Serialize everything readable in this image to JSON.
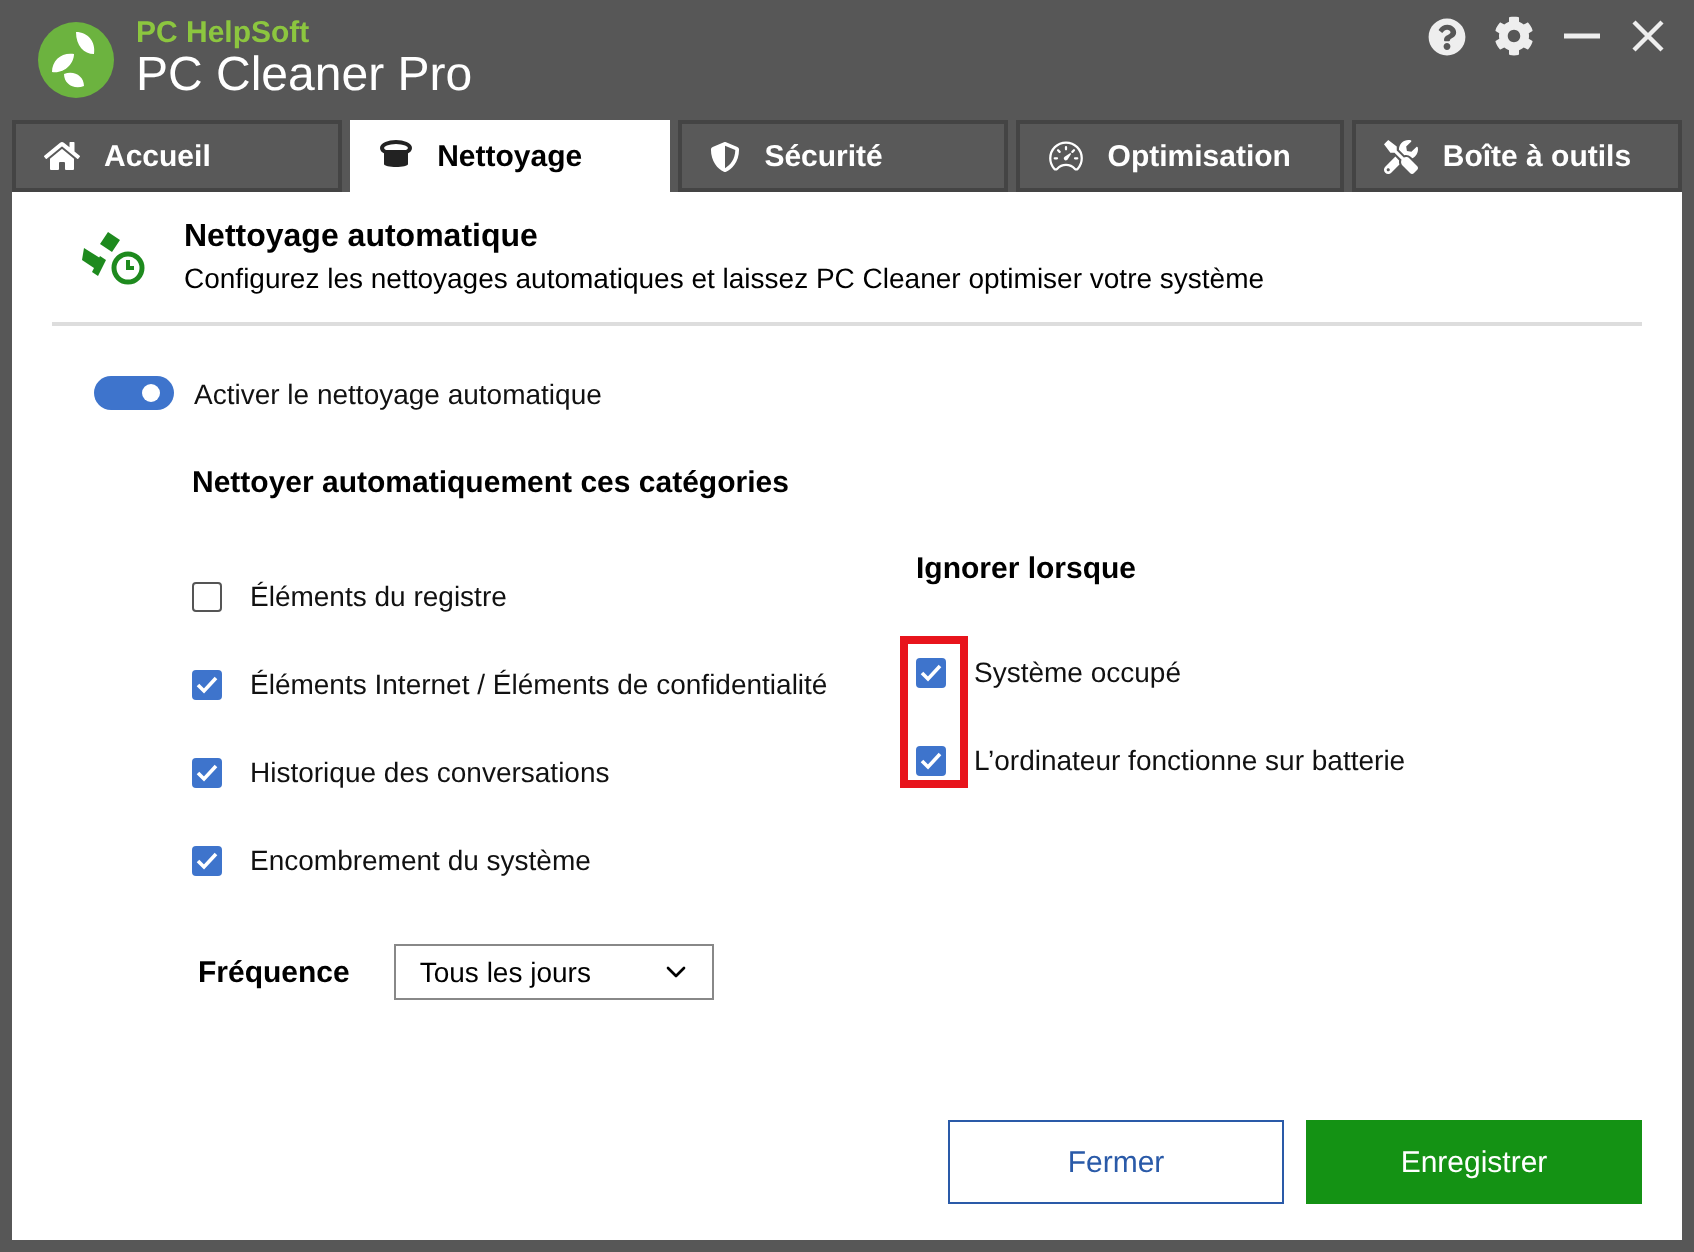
{
  "app": {
    "brand": "PC HelpSoft",
    "title": "PC Cleaner Pro"
  },
  "tabs": [
    {
      "label": "Accueil",
      "kind": "home",
      "selected": false
    },
    {
      "label": "Nettoyage",
      "kind": "clean",
      "selected": true
    },
    {
      "label": "Sécurité",
      "kind": "shield",
      "selected": false
    },
    {
      "label": "Optimisation",
      "kind": "gauge",
      "selected": false
    },
    {
      "label": "Boîte à outils",
      "kind": "tools",
      "selected": false
    }
  ],
  "header": {
    "title": "Nettoyage automatique",
    "subtitle": "Configurez les nettoyages automatiques et laissez PC Cleaner optimiser votre système"
  },
  "toggle": {
    "label": "Activer le nettoyage automatique",
    "on": true
  },
  "categories": {
    "heading": "Nettoyer automatiquement ces catégories",
    "items": [
      {
        "label": "Éléments du registre",
        "checked": false
      },
      {
        "label": "Éléments Internet / Éléments de confidentialité",
        "checked": true
      },
      {
        "label": "Historique des conversations",
        "checked": true
      },
      {
        "label": "Encombrement du système",
        "checked": true
      }
    ]
  },
  "ignore": {
    "heading": "Ignorer lorsque",
    "highlighted": true,
    "items": [
      {
        "label": "Système occupé",
        "checked": true
      },
      {
        "label": "L’ordinateur fonctionne sur batterie",
        "checked": true
      }
    ]
  },
  "frequency": {
    "label": "Fréquence",
    "value": "Tous les jours"
  },
  "buttons": [
    {
      "label": "Fermer",
      "kind": "secondary"
    },
    {
      "label": "Enregistrer",
      "kind": "primary"
    }
  ]
}
